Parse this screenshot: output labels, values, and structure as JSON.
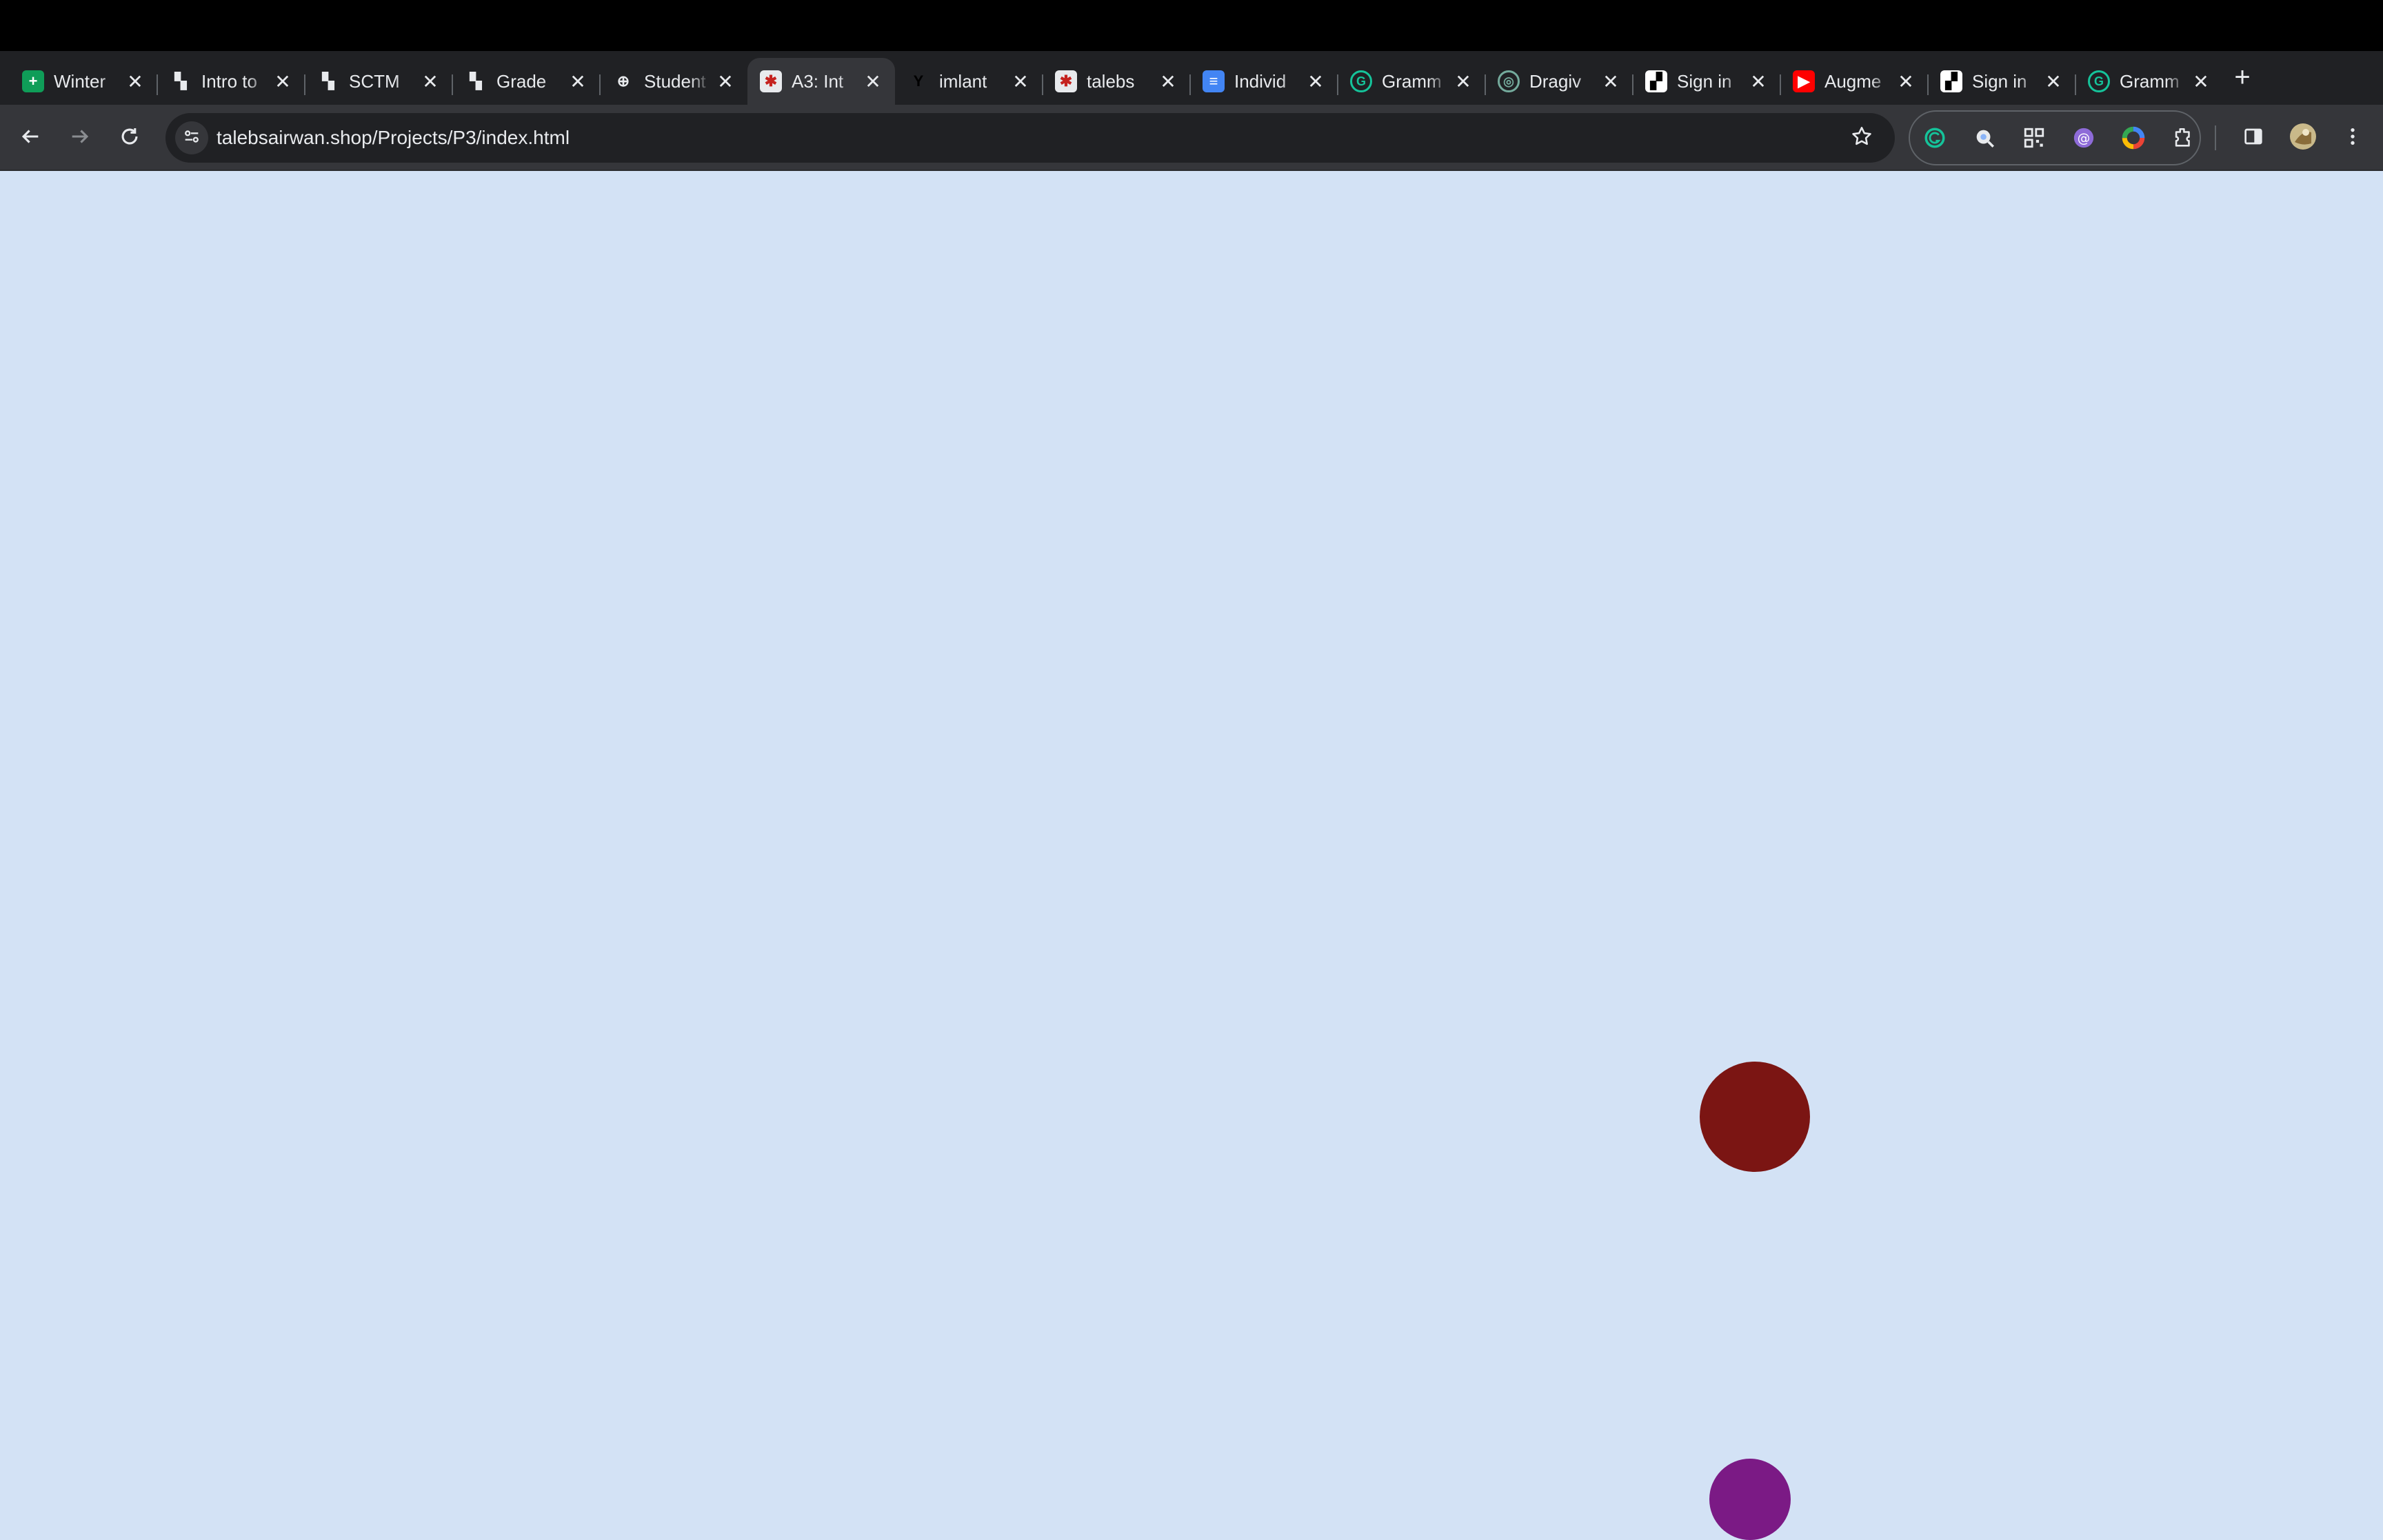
{
  "browser": {
    "tabs": [
      {
        "title": "Winter",
        "favicon": "google-sheets-icon",
        "favicon_color": "#0f9d58",
        "favicon_glyph": "+"
      },
      {
        "title": "Intro to",
        "favicon": "canvas-doc-icon",
        "favicon_color": "#5f6368",
        "favicon_glyph": "▚"
      },
      {
        "title": "SCTM",
        "favicon": "canvas-doc-icon",
        "favicon_color": "#5f6368",
        "favicon_glyph": "▚"
      },
      {
        "title": "Grade",
        "favicon": "canvas-doc-icon",
        "favicon_color": "#5f6368",
        "favicon_glyph": "▚"
      },
      {
        "title": "Student",
        "favicon": "globe-icon",
        "favicon_color": "#5f6368",
        "favicon_glyph": "⊕"
      },
      {
        "title": "A3: Int",
        "favicon": "app-icon",
        "favicon_color": "#e8eaed",
        "favicon_glyph": "✱",
        "active": true
      },
      {
        "title": "imlant",
        "favicon": "y-icon",
        "favicon_color": "#202124",
        "favicon_glyph": "Y"
      },
      {
        "title": "talebs",
        "favicon": "app-icon",
        "favicon_color": "#e8eaed",
        "favicon_glyph": "✱"
      },
      {
        "title": "Individ",
        "favicon": "google-docs-icon",
        "favicon_color": "#4285f4",
        "favicon_glyph": "≡"
      },
      {
        "title": "Gramm",
        "favicon": "grammarly-icon",
        "favicon_color": "#15c39a",
        "favicon_glyph": "G"
      },
      {
        "title": "Dragiv",
        "favicon": "chatgpt-icon",
        "favicon_color": "#74aa9c",
        "favicon_glyph": "◎"
      },
      {
        "title": "Sign in",
        "favicon": "checker-icon",
        "favicon_color": "#ffffff",
        "favicon_glyph": "▞"
      },
      {
        "title": "Augme",
        "favicon": "youtube-icon",
        "favicon_color": "#ff0000",
        "favicon_glyph": "▶"
      },
      {
        "title": "Sign in",
        "favicon": "checker-icon",
        "favicon_color": "#ffffff",
        "favicon_glyph": "▞"
      },
      {
        "title": "Gramm",
        "favicon": "grammarly-icon",
        "favicon_color": "#15c39a",
        "favicon_glyph": "G"
      }
    ],
    "address_bar": {
      "url": "talebsairwan.shop/Projects/P3/index.html"
    },
    "extensions": [
      {
        "name": "grammarly-extension-icon",
        "color": "#15c39a"
      },
      {
        "name": "lens-extension-icon",
        "color": "#8ab4f8"
      },
      {
        "name": "qr-code-extension-icon",
        "color": "#e8eaed"
      },
      {
        "name": "at-sign-extension-icon",
        "color": "#8e6bd8"
      },
      {
        "name": "color-wheel-extension-icon",
        "color": "#f4b400"
      },
      {
        "name": "extensions-puzzle-icon",
        "color": "#e8eaed"
      }
    ]
  },
  "page": {
    "background_color": "#d3e2f5",
    "balls": [
      {
        "name": "dark-red-ball",
        "color": "#7b1513"
      },
      {
        "name": "purple-ball",
        "color": "#7b1a85"
      }
    ]
  }
}
